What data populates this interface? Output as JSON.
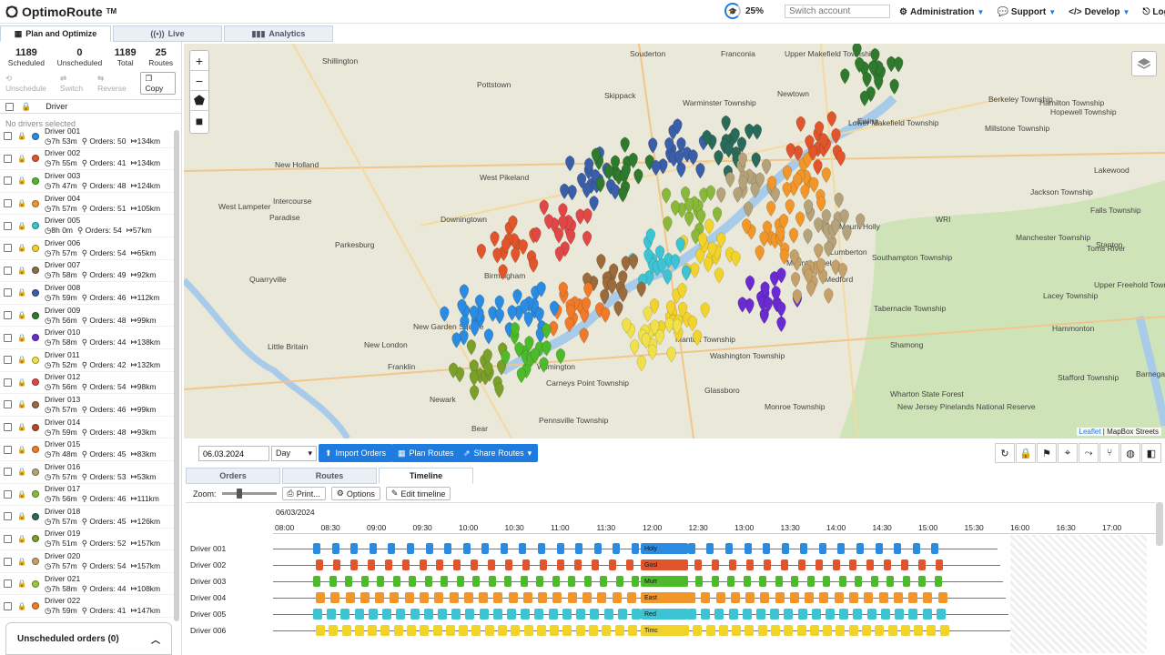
{
  "app": {
    "name": "OptimoRoute",
    "trademark": "TM",
    "progress": "25%",
    "switch_placeholder": "Switch account"
  },
  "topnav": [
    {
      "label": "Administration",
      "icon": "gear-icon",
      "caret": true
    },
    {
      "label": "Support",
      "icon": "chat-icon",
      "caret": true
    },
    {
      "label": "Develop",
      "icon": "code-icon",
      "caret": true
    },
    {
      "label": "Logout",
      "icon": "logout-icon",
      "caret": false
    }
  ],
  "tabs": [
    {
      "label": "Plan and Optimize",
      "icon": "calendar-icon",
      "active": true
    },
    {
      "label": "Live",
      "icon": "broadcast-icon",
      "active": false
    },
    {
      "label": "Analytics",
      "icon": "bar-chart-icon",
      "active": false
    }
  ],
  "stats": [
    {
      "value": "1189",
      "label": "Scheduled"
    },
    {
      "value": "0",
      "label": "Unscheduled"
    },
    {
      "value": "1189",
      "label": "Total"
    },
    {
      "value": "25",
      "label": "Routes"
    }
  ],
  "actions": {
    "unschedule": "Unschedule",
    "switch": "Switch",
    "reverse": "Reverse",
    "copy": "Copy"
  },
  "driver_header": "Driver",
  "no_drivers": "No drivers selected",
  "drivers": [
    {
      "name": "Driver 001",
      "time": "7h 53m",
      "orders": "Orders: 50",
      "dist": "134km",
      "color": "#2b8be0"
    },
    {
      "name": "Driver 002",
      "time": "7h 55m",
      "orders": "Orders: 41",
      "dist": "134km",
      "color": "#e0552b"
    },
    {
      "name": "Driver 003",
      "time": "7h 47m",
      "orders": "Orders: 48",
      "dist": "124km",
      "color": "#4cba2a"
    },
    {
      "name": "Driver 004",
      "time": "7h 57m",
      "orders": "Orders: 51",
      "dist": "105km",
      "color": "#f0962a"
    },
    {
      "name": "Driver 005",
      "time": "8h 0m",
      "orders": "Orders: 54",
      "dist": "57km",
      "color": "#3cc4d4"
    },
    {
      "name": "Driver 006",
      "time": "7h 57m",
      "orders": "Orders: 54",
      "dist": "65km",
      "color": "#f2d32c"
    },
    {
      "name": "Driver 007",
      "time": "7h 58m",
      "orders": "Orders: 49",
      "dist": "92km",
      "color": "#8a6e4b"
    },
    {
      "name": "Driver 008",
      "time": "7h 59m",
      "orders": "Orders: 46",
      "dist": "112km",
      "color": "#3a5fa8"
    },
    {
      "name": "Driver 009",
      "time": "7h 56m",
      "orders": "Orders: 48",
      "dist": "99km",
      "color": "#2f7a2f"
    },
    {
      "name": "Driver 010",
      "time": "7h 58m",
      "orders": "Orders: 44",
      "dist": "138km",
      "color": "#6a2bd0"
    },
    {
      "name": "Driver 011",
      "time": "7h 52m",
      "orders": "Orders: 42",
      "dist": "132km",
      "color": "#f0e04a"
    },
    {
      "name": "Driver 012",
      "time": "7h 56m",
      "orders": "Orders: 54",
      "dist": "98km",
      "color": "#e04848"
    },
    {
      "name": "Driver 013",
      "time": "7h 57m",
      "orders": "Orders: 46",
      "dist": "99km",
      "color": "#9a6b3c"
    },
    {
      "name": "Driver 014",
      "time": "7h 59m",
      "orders": "Orders: 48",
      "dist": "93km",
      "color": "#b14a2a"
    },
    {
      "name": "Driver 015",
      "time": "7h 48m",
      "orders": "Orders: 45",
      "dist": "83km",
      "color": "#f07a2a"
    },
    {
      "name": "Driver 016",
      "time": "7h 57m",
      "orders": "Orders: 53",
      "dist": "53km",
      "color": "#b4a27a"
    },
    {
      "name": "Driver 017",
      "time": "7h 56m",
      "orders": "Orders: 46",
      "dist": "111km",
      "color": "#8ab83a"
    },
    {
      "name": "Driver 018",
      "time": "7h 57m",
      "orders": "Orders: 45",
      "dist": "126km",
      "color": "#2a6a5a"
    },
    {
      "name": "Driver 019",
      "time": "7h 51m",
      "orders": "Orders: 52",
      "dist": "157km",
      "color": "#7aa02a"
    },
    {
      "name": "Driver 020",
      "time": "7h 57m",
      "orders": "Orders: 54",
      "dist": "157km",
      "color": "#c4a06a"
    },
    {
      "name": "Driver 021",
      "time": "7h 58m",
      "orders": "Orders: 44",
      "dist": "108km",
      "color": "#9ac83a"
    },
    {
      "name": "Driver 022",
      "time": "7h 59m",
      "orders": "Orders: 41",
      "dist": "147km",
      "color": "#f07a2a"
    }
  ],
  "unscheduled": "Unscheduled orders (0)",
  "map": {
    "places": [
      "Shillington",
      "Pottstown",
      "Souderton",
      "Franconia",
      "Upper Makefield Township",
      "Warminster Township",
      "Skippack",
      "Newtown",
      "Lower Makefield Township",
      "Ewing",
      "New Holland",
      "West Pikeland",
      "Intercourse",
      "West Lampeter",
      "Paradise",
      "Downingtown",
      "Parkesburg",
      "Quarryville",
      "Birmingham",
      "New Garden Square",
      "Little Britain",
      "New London",
      "Franklin",
      "Newark",
      "Bear",
      "Wilmington",
      "Carneys Point Township",
      "Pennsville Township",
      "Glassboro",
      "Washington Township",
      "Monroe Township",
      "Mantua Township",
      "Mount Laurel",
      "Medford",
      "Lumberton",
      "Mount Holly",
      "Southampton Township",
      "Tabernacle Township",
      "Shamong",
      "Manchester Township",
      "Jackson Township",
      "Toms River",
      "Lacey Township",
      "Barnegat Township",
      "Stafford Township",
      "New Jersey Pinelands National Reserve",
      "Wharton State Forest",
      "Hamilton Township",
      "Hopewell Township",
      "Millstone Township",
      "Berkeley Township",
      "Lakewood",
      "Falls Township",
      "Upper Freehold Township",
      "Stanton",
      "Hammonton",
      "WRI"
    ],
    "attribution_leaflet": "Leaflet",
    "attribution_tiles": "MapBox Streets"
  },
  "toolbar": {
    "date": "06.03.2024",
    "period": "Day",
    "import": "Import Orders",
    "plan": "Plan Routes",
    "share": "Share Routes"
  },
  "subtabs": [
    {
      "label": "Orders",
      "active": false
    },
    {
      "label": "Routes",
      "active": false
    },
    {
      "label": "Timeline",
      "active": true
    }
  ],
  "timeline": {
    "zoom_label": "Zoom:",
    "print": "Print...",
    "options": "Options",
    "edit": "Edit timeline",
    "date": "06/03/2024",
    "ticks": [
      "08:00",
      "08:30",
      "09:00",
      "09:30",
      "10:00",
      "10:30",
      "11:00",
      "11:30",
      "12:00",
      "12:30",
      "13:00",
      "13:30",
      "14:00",
      "14:30",
      "15:00",
      "15:30",
      "16:00",
      "16:30",
      "17:00"
    ],
    "rows": [
      {
        "name": "Driver 001",
        "color": "#2b8be0",
        "break": "Holy"
      },
      {
        "name": "Driver 002",
        "color": "#e0552b",
        "break": "Gosl"
      },
      {
        "name": "Driver 003",
        "color": "#4cba2a",
        "break": "Murr"
      },
      {
        "name": "Driver 004",
        "color": "#f0962a",
        "break": "East"
      },
      {
        "name": "Driver 005",
        "color": "#3cc4d4",
        "break": "Red"
      },
      {
        "name": "Driver 006",
        "color": "#f2d32c",
        "break": "Timc"
      }
    ]
  }
}
